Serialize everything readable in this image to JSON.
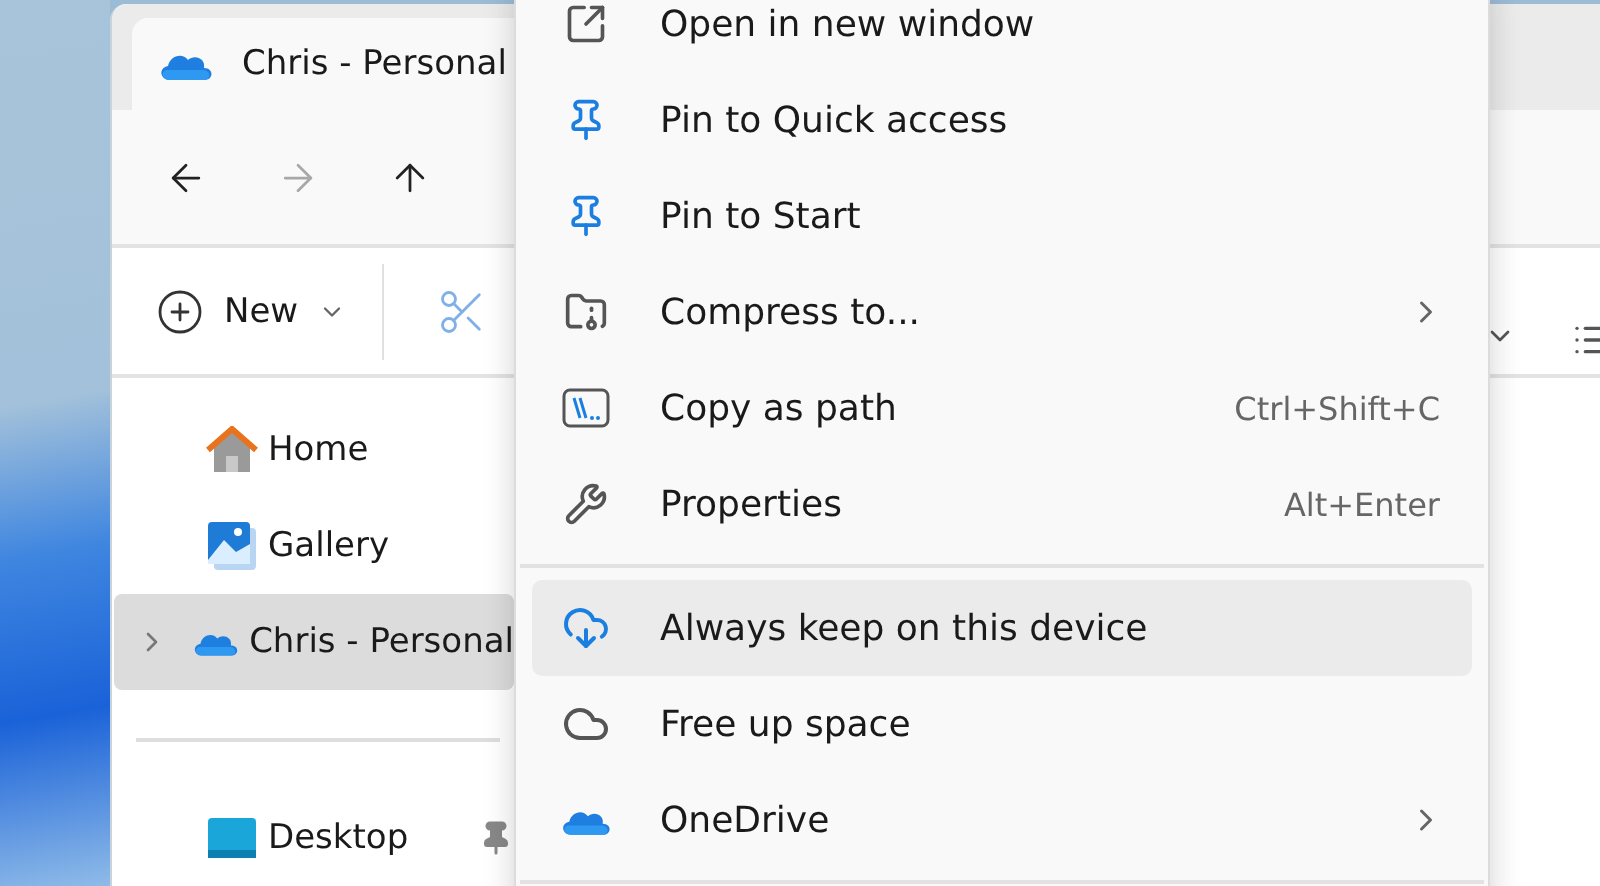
{
  "tab": {
    "title": "Chris - Personal"
  },
  "nav": [
    {
      "disabled": false
    },
    {
      "disabled": true
    },
    {
      "disabled": false
    }
  ],
  "toolbar": {
    "new_label": "New"
  },
  "sidebar": {
    "groups": [
      [
        {
          "label": "Home",
          "selected": false,
          "expandable": false,
          "pinned": false
        },
        {
          "label": "Gallery",
          "selected": false,
          "expandable": false,
          "pinned": false
        },
        {
          "label": "Chris - Personal",
          "selected": true,
          "expandable": true,
          "pinned": false
        }
      ],
      [
        {
          "label": "Desktop",
          "selected": false,
          "expandable": false,
          "pinned": true
        }
      ]
    ]
  },
  "context_menu": {
    "groups": [
      [
        {
          "label": "Open in new window",
          "submenu": false,
          "selected": false
        },
        {
          "label": "Pin to Quick access",
          "submenu": false,
          "selected": false
        },
        {
          "label": "Pin to Start",
          "submenu": false,
          "selected": false
        },
        {
          "label": "Compress to...",
          "submenu": true,
          "selected": false
        },
        {
          "label": "Copy as path",
          "shortcut": "Ctrl+Shift+C",
          "submenu": false,
          "selected": false
        },
        {
          "label": "Properties",
          "shortcut": "Alt+Enter",
          "submenu": false,
          "selected": false
        }
      ],
      [
        {
          "label": "Always keep on this device",
          "submenu": false,
          "selected": true
        },
        {
          "label": "Free up space",
          "submenu": false,
          "selected": false
        },
        {
          "label": "OneDrive",
          "submenu": true,
          "selected": false
        }
      ]
    ]
  }
}
